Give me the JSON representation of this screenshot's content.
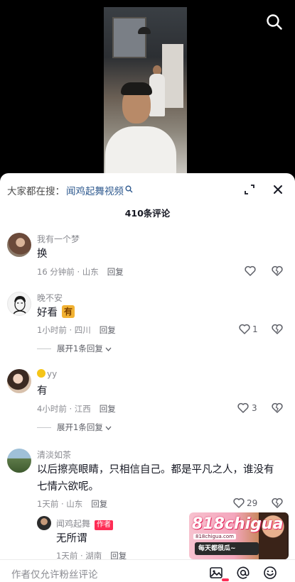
{
  "search_hint": {
    "prefix": "大家都在搜：",
    "term": "闻鸡起舞视频"
  },
  "comment_count": "410条评论",
  "comments": [
    {
      "user": "我有一个梦",
      "text": "换",
      "time_location": "16 分钟前 · 山东",
      "reply_label": "回复",
      "likes": ""
    },
    {
      "user": "晚不安",
      "text": "好看",
      "tag": "有",
      "time_location": "1小时前 · 四川",
      "reply_label": "回复",
      "likes": "1",
      "expand_label": "展开1条回复"
    },
    {
      "user": "yy",
      "text": "有",
      "time_location": "4小时前 · 江西",
      "reply_label": "回复",
      "likes": "3",
      "expand_label": "展开1条回复"
    },
    {
      "user": "清淡如茶",
      "text": "以后擦亮眼睛，只相信自己。都是平凡之人，谁没有七情六欲呢。",
      "time_location": "1天前 · 山东",
      "reply_label": "回复",
      "likes": "29"
    }
  ],
  "author_reply": {
    "user": "闻鸡起舞",
    "badge": "作者",
    "text": "无所谓",
    "time_location": "1天前 · 湖南",
    "reply_label": "回复"
  },
  "ad": {
    "logo": "818chigua",
    "sub": "818chigua.com",
    "banner": "每天都很瓜~"
  },
  "input": {
    "placeholder": "作者仅允许粉丝评论"
  },
  "icons": {
    "top": "search-icon",
    "sheet": [
      "expand-icon",
      "close-icon"
    ],
    "input_bar": [
      "image-icon",
      "at-icon",
      "emoji-icon"
    ]
  }
}
